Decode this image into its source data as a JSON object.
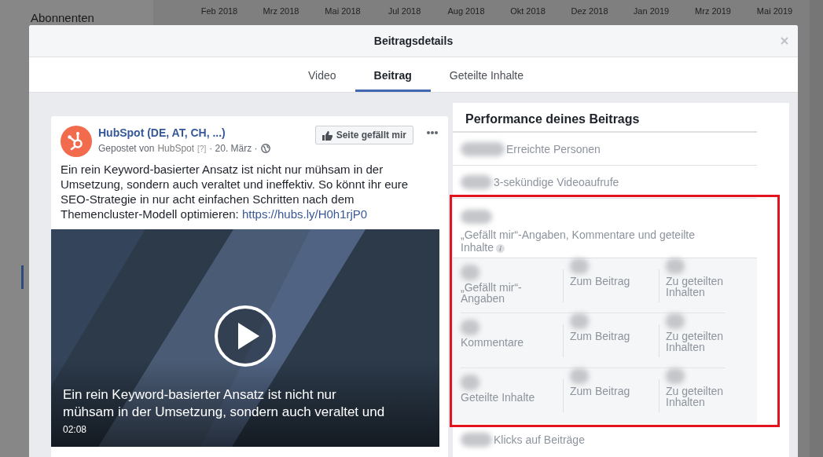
{
  "background": {
    "sidebar": [
      {
        "label": "Abonnenten"
      }
    ],
    "timeline_labels": [
      "Feb 2018",
      "Mrz 2018",
      "Mai 2018",
      "Jul 2018",
      "Aug 2018",
      "Okt 2018",
      "Dez 2018",
      "Jan 2019",
      "Mrz 2019",
      "Mai 2019"
    ]
  },
  "dialog": {
    "title": "Beitragsdetails",
    "tabs": [
      {
        "label": "Video",
        "selected": false
      },
      {
        "label": "Beitrag",
        "selected": true
      },
      {
        "label": "Geteilte Inhalte",
        "selected": false
      }
    ],
    "post": {
      "page_name": "HubSpot (DE, AT, CH, ...)",
      "posted_by": "Gepostet von",
      "author": "HubSpot",
      "help": "[?]",
      "date": "· 20. März ·",
      "like_button": "Seite gefällt mir",
      "body": "Ein rein Keyword-basierter Ansatz ist nicht nur mühsam in der Umsetzung, sondern auch veraltet und ineffektiv. So könnt ihr eure SEO-Strategie in nur acht einfachen Schritten nach dem Themencluster-Modell optimieren: ",
      "link": "https://hubs.ly/H0h1rjP0",
      "video": {
        "kind": "picture",
        "caption_lines": [
          "Ein rein Keyword-basierter Ansatz ist nicht nur",
          "mühsam in der Umsetzung, sondern auch veraltet und"
        ],
        "duration": "02:08"
      }
    },
    "performance": {
      "title": "Performance deines Beitrags",
      "metrics": [
        {
          "kind": "simple",
          "label": "Erreichte Personen",
          "highlighted": false
        },
        {
          "kind": "simple",
          "label": "3-sekündige Videoaufrufe",
          "highlighted": false
        },
        {
          "kind": "engagement",
          "label": "„Gefällt mir“-Angaben, Kommentare und geteilte Inhalte",
          "highlighted": true,
          "breakdown": [
            {
              "label": "„Gefällt mir“-Angaben",
              "columns": [
                "Zum Beitrag",
                "Zu geteilten Inhalten"
              ]
            },
            {
              "label": "Kommentare",
              "columns": [
                "Zum Beitrag",
                "Zu geteilten Inhalten"
              ]
            },
            {
              "label": "Geteilte Inhalte",
              "columns": [
                "Zum Beitrag",
                "Zu geteilten Inhalten"
              ]
            }
          ]
        },
        {
          "kind": "simple",
          "label": "Klicks auf Beiträge",
          "highlighted": false
        }
      ]
    }
  }
}
